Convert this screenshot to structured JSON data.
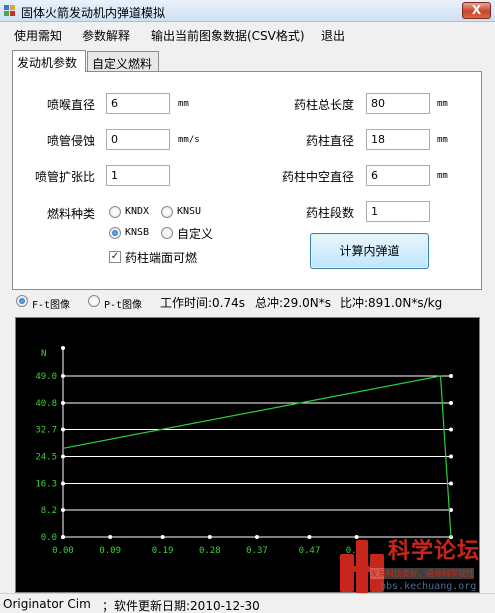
{
  "window": {
    "title": "固体火箭发动机内弹道模拟",
    "close_label": "X"
  },
  "menu": [
    "使用需知",
    "参数解释",
    "输出当前图象数据(CSV格式)",
    "退出"
  ],
  "tabs": [
    {
      "label": "发动机参数",
      "active": true
    },
    {
      "label": "自定义燃料",
      "active": false
    }
  ],
  "params": {
    "throat_diameter": {
      "label": "喷喉直径",
      "value": "6",
      "unit": "mm"
    },
    "nozzle_erosion": {
      "label": "喷管侵蚀",
      "value": "0",
      "unit": "mm/s"
    },
    "expansion_ratio": {
      "label": "喷管扩张比",
      "value": "1"
    },
    "grain_length": {
      "label": "药柱总长度",
      "value": "80",
      "unit": "mm"
    },
    "grain_diameter": {
      "label": "药柱直径",
      "value": "18",
      "unit": "mm"
    },
    "core_diameter": {
      "label": "药柱中空直径",
      "value": "6",
      "unit": "mm"
    },
    "segments": {
      "label": "药柱段数",
      "value": "1"
    }
  },
  "fuel": {
    "label": "燃料种类",
    "options": [
      "KNDX",
      "KNSU",
      "KNSB",
      "自定义"
    ],
    "selected": "KNSB",
    "end_burn_label": "药柱端面可燃",
    "end_burn_checked": true
  },
  "calc_button": "计算内弹道",
  "readout": {
    "ft_label": "F-t图像",
    "pt_label": "P-t图像",
    "selected": "ft",
    "work_time": "工作时间:0.74s",
    "total_impulse": "总冲:29.0N*s",
    "specific_impulse": "比冲:891.0N*s/kg"
  },
  "chart_data": {
    "type": "line",
    "ylabel": "N",
    "yticks": [
      "0.0",
      "8.2",
      "16.3",
      "24.5",
      "32.7",
      "40.8",
      "49.0"
    ],
    "xticks": [
      "0.00",
      "0.09",
      "0.19",
      "0.28",
      "0.37",
      "0.47",
      "0.56"
    ],
    "xlim": [
      0,
      0.74
    ],
    "ylim": [
      0,
      49.0
    ],
    "grid": true,
    "series": [
      {
        "x": [
          0.0,
          0.72,
          0.74
        ],
        "y": [
          27.0,
          49.0,
          0.0
        ]
      }
    ],
    "colors": {
      "background": "#000000",
      "grid": "#ffffff",
      "line": "#2ecc40",
      "tick_text": "#3ad13a"
    }
  },
  "status": {
    "author": "Originator Cim",
    "update": "；软件更新日期:2010-12-30"
  },
  "watermark": {
    "title": "科学论坛",
    "tagline": "发展科技爱好、倡导科学理性",
    "url": "bbs.kechuang.org"
  }
}
